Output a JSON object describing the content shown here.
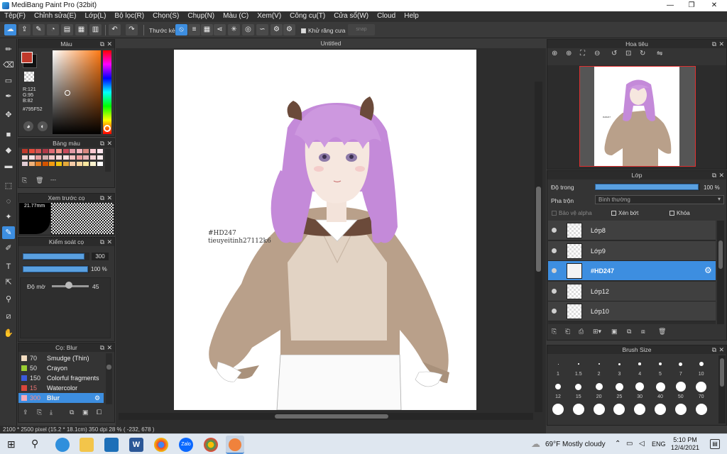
{
  "window": {
    "title": "MediBang Paint Pro (32bit)",
    "minimize": "—",
    "maximize": "❐",
    "close": "✕"
  },
  "menu": [
    "Tệp(F)",
    "Chỉnh sửa(E)",
    "Lớp(L)",
    "Bộ lọc(R)",
    "Chọn(S)",
    "Chụp(N)",
    "Màu (C)",
    "Xem(V)",
    "Công cụ(T)",
    "Cửa sổ(W)",
    "Cloud",
    "Help"
  ],
  "toolbar": {
    "ruler_label": "Thước kẻ",
    "antialias_label": "Khử răng cưa",
    "snap_label": "snap"
  },
  "color_panel": {
    "title": "Màu",
    "r": "R:121",
    "g": "G:95",
    "b": "B:82",
    "hex": "#795F52",
    "fg_color": "#c0392b",
    "bg_color": "#111111"
  },
  "palette_panel": {
    "title": "Bảng màu",
    "footer": "---"
  },
  "brush_preview": {
    "title": "Xem trước cọ",
    "size": "21.77mm"
  },
  "brush_control": {
    "title": "Kiểm soát cọ",
    "size_value": "300",
    "size_fraction": 0.95,
    "opacity_value": "100 %",
    "opacity_fraction": 1.0,
    "blur_label": "Độ mờ",
    "blur_value": "45"
  },
  "brush_list": {
    "title": "Cọ: Blur",
    "items": [
      {
        "size": "70",
        "name": "Smudge (Thin)",
        "color": "#f2dcc0"
      },
      {
        "size": "50",
        "name": "Crayon",
        "color": "#9acd32"
      },
      {
        "size": "150",
        "name": "Colorful fragments",
        "color": "#3b5bdb"
      },
      {
        "size": "15",
        "name": "Watercolor",
        "color": "#d9463b"
      },
      {
        "size": "300",
        "name": "Blur",
        "color": "#f4a9b8"
      }
    ]
  },
  "document": {
    "tab": "Untitled",
    "watermark_line1": "#HD247",
    "watermark_line2": "tieuyeitinh27112k6"
  },
  "status": {
    "text": "2100 * 2500 pixel  (15.2 * 18.1cm)  350 dpi  28 %  ( -232, 678 )"
  },
  "navigator": {
    "title": "Hoa tiêu"
  },
  "layers_panel": {
    "title": "Lớp",
    "opacity_label": "Độ trong",
    "opacity_value": "100 %",
    "opacity_fraction": 1.0,
    "blend_label": "Pha trộn",
    "blend_value": "Bình thường",
    "protect_alpha": "Bảo vệ alpha",
    "clipping": "Xén bớt",
    "lock": "Khóa",
    "layers": [
      {
        "name": "Lớp8",
        "selected": false
      },
      {
        "name": "Lớp9",
        "selected": false
      },
      {
        "name": "#HD247",
        "selected": true
      },
      {
        "name": "Lớp12",
        "selected": false
      },
      {
        "name": "Lớp10",
        "selected": false
      }
    ]
  },
  "brush_size_panel": {
    "title": "Brush Size",
    "row1": [
      "1",
      "1.5",
      "2",
      "3",
      "4",
      "5",
      "7",
      "10"
    ],
    "row2": [
      "12",
      "15",
      "20",
      "25",
      "30",
      "40",
      "50",
      "70"
    ]
  },
  "taskbar": {
    "weather": "69°F  Mostly cloudy",
    "lang": "ENG",
    "time": "5:10 PM",
    "date": "12/4/2021"
  }
}
